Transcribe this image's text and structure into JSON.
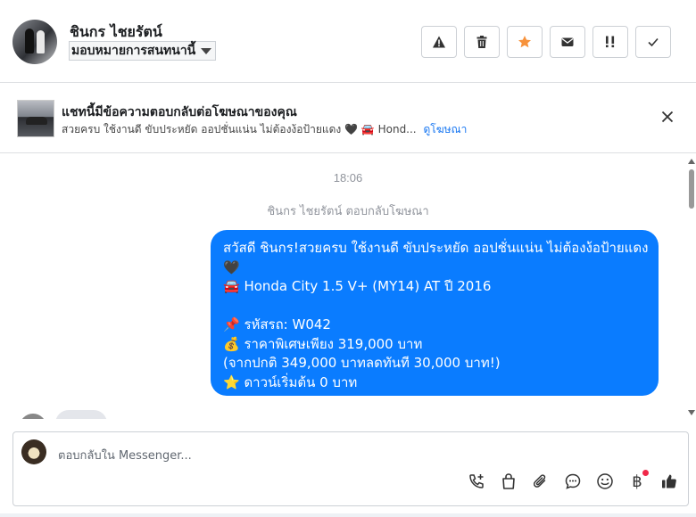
{
  "header": {
    "contact_name": "ชินกร ไชยรัตน์",
    "assign_label": "มอบหมายการสนทนานี้",
    "actions": [
      {
        "name": "report-button",
        "icon": "warning-icon"
      },
      {
        "name": "delete-button",
        "icon": "trash-icon"
      },
      {
        "name": "star-button",
        "icon": "star-icon"
      },
      {
        "name": "mark-unread-button",
        "icon": "envelope-icon"
      },
      {
        "name": "follow-up-button",
        "icon": "follow-up-icon"
      },
      {
        "name": "mark-done-button",
        "icon": "check-icon"
      }
    ]
  },
  "ad": {
    "title": "แชทนี้มีข้อความตอบกลับต่อโฆษณาของคุณ",
    "snippet": "สวยครบ ใช้งานดี ขับประหยัด ออปชั่นแน่น ไม่ต้องง้อป้ายแดง 🖤 🚘 Hond...",
    "link": "ดูโฆษณา"
  },
  "thread": {
    "time": "18:06",
    "replied_note": "ชินกร ไชยรัตน์ ตอบกลับโฆษณา",
    "message_lines": [
      "สวัสดี ชินกร!สวยครบ ใช้งานดี ขับประหยัด ออปชั่นแน่น ไม่ต้องง้อป้ายแดง",
      "🖤",
      "🚘 Honda City 1.5 V+ (MY14) AT ปี 2016",
      "",
      "📌 รหัสรถ: W042",
      "💰 ราคาพิเศษเพียง 319,000 บาท",
      "(จากปกติ 349,000 บาทลดทันที 30,000 บาท!)",
      "⭐ ดาวน์เริ่มต้น 0 บาท"
    ]
  },
  "composer": {
    "placeholder": "ตอบกลับใน Messenger...",
    "baht_symbol": "฿"
  },
  "colors": {
    "bubble": "#0a7cff",
    "star": "#f7923b",
    "link": "#1877f2",
    "badge": "#f02849"
  }
}
